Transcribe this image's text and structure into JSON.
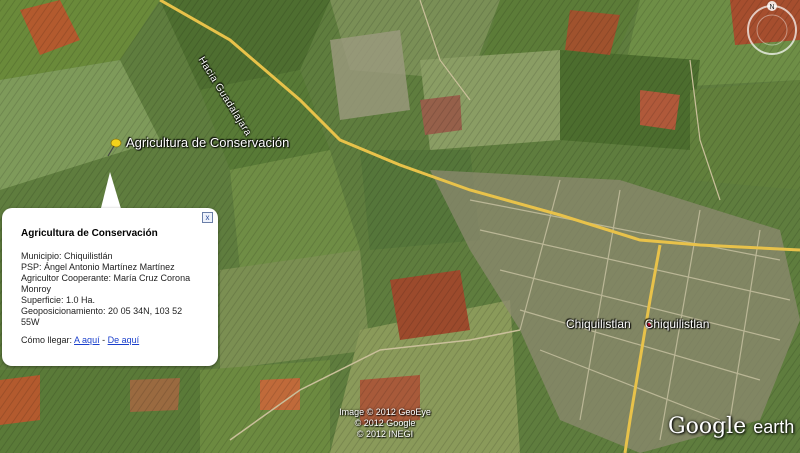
{
  "map": {
    "road_label": "Hacia Guadalajara",
    "pin_label": "Agricultura de Conservación",
    "town_label": "Chiquilistlan",
    "town_label_2": "Chiquilistlan",
    "attribution": [
      "Image © 2012 GeoEye",
      "© 2012 Google",
      "© 2012 INEGI"
    ],
    "logo_main": "Google",
    "logo_sub": "earth",
    "compass_letter": "N"
  },
  "balloon": {
    "title": "Agricultura de Conservación",
    "lines": [
      "Municipio: Chiquilistlán",
      "PSP: Ángel Antonio Martínez Martínez",
      "Agricultor Cooperante: María Cruz Corona Monroy",
      "Superficie: 1.0 Ha.",
      "Geoposicionamiento: 20 05 34N, 103 52 55W"
    ],
    "directions_label": "Cómo llegar:",
    "link_to": "A aquí",
    "separator": "-",
    "link_from": "De aquí",
    "close_symbol": "x"
  },
  "colors": {
    "road": "#e8c24a",
    "pin": "#f2d21b",
    "link": "#1a3fcc"
  }
}
